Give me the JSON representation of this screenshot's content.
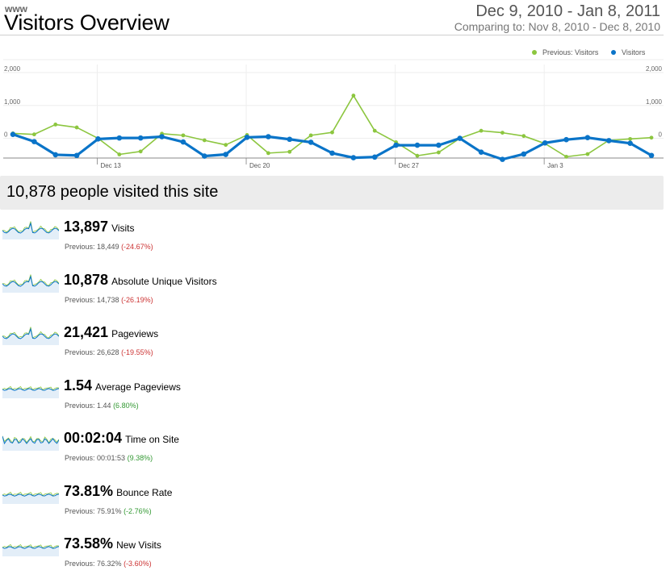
{
  "header": {
    "profile_name": "www",
    "title": "Visitors Overview",
    "date_range": "Dec 9, 2010 - Jan 8, 2011",
    "comparing": "Comparing to: Nov 8, 2010 - Dec 8, 2010"
  },
  "chart_data": {
    "type": "line",
    "legend_position": "top-right",
    "legend": [
      "Previous: Visitors",
      "Visitors"
    ],
    "y_ticks": [
      "2,000",
      "1,000",
      "0"
    ],
    "ylim": [
      -600,
      2000
    ],
    "x_ticks": [
      {
        "index": 4,
        "label": "Dec 13"
      },
      {
        "index": 11,
        "label": "Dec 20"
      },
      {
        "index": 18,
        "label": "Dec 27"
      },
      {
        "index": 25,
        "label": "Jan 3"
      }
    ],
    "grid": true,
    "series": [
      {
        "name": "Previous: Visitors",
        "color": "#8cc63f",
        "values": [
          150,
          120,
          420,
          330,
          0,
          -490,
          -400,
          140,
          90,
          -60,
          -200,
          100,
          -450,
          -410,
          90,
          180,
          1300,
          230,
          -120,
          -530,
          -430,
          0,
          230,
          170,
          70,
          -160,
          -560,
          -480,
          -60,
          -20,
          20
        ]
      },
      {
        "name": "Visitors",
        "color": "#0a74c8",
        "values": [
          120,
          -100,
          -500,
          -520,
          -20,
          10,
          10,
          50,
          -110,
          -540,
          -490,
          30,
          50,
          -30,
          -120,
          -450,
          -590,
          -570,
          -210,
          -210,
          -210,
          0,
          -420,
          -640,
          -480,
          -140,
          -40,
          20,
          -70,
          -150,
          -520
        ]
      }
    ]
  },
  "summary": {
    "text": "10,878 people visited this site"
  },
  "metrics": [
    {
      "value": "13,897",
      "label": "Visits",
      "previous_text": "Previous: 18,449",
      "change": "(-24.67%)",
      "change_sign": "neg",
      "spark_style": "wave"
    },
    {
      "value": "10,878",
      "label": "Absolute Unique Visitors",
      "previous_text": "Previous: 14,738",
      "change": "(-26.19%)",
      "change_sign": "neg",
      "spark_style": "wave"
    },
    {
      "value": "21,421",
      "label": "Pageviews",
      "previous_text": "Previous: 26,628",
      "change": "(-19.55%)",
      "change_sign": "neg",
      "spark_style": "wave"
    },
    {
      "value": "1.54",
      "label": "Average Pageviews",
      "previous_text": "Previous: 1.44",
      "change": "(6.80%)",
      "change_sign": "pos",
      "spark_style": "flat"
    },
    {
      "value": "00:02:04",
      "label": "Time on Site",
      "previous_text": "Previous: 00:01:53",
      "change": "(9.38%)",
      "change_sign": "pos",
      "spark_style": "noisy"
    },
    {
      "value": "73.81%",
      "label": "Bounce Rate",
      "previous_text": "Previous: 75.91%",
      "change": "(-2.76%)",
      "change_sign": "pos",
      "spark_style": "flat"
    },
    {
      "value": "73.58%",
      "label": "New Visits",
      "previous_text": "Previous: 76.32%",
      "change": "(-3.60%)",
      "change_sign": "neg",
      "spark_style": "flat"
    }
  ]
}
